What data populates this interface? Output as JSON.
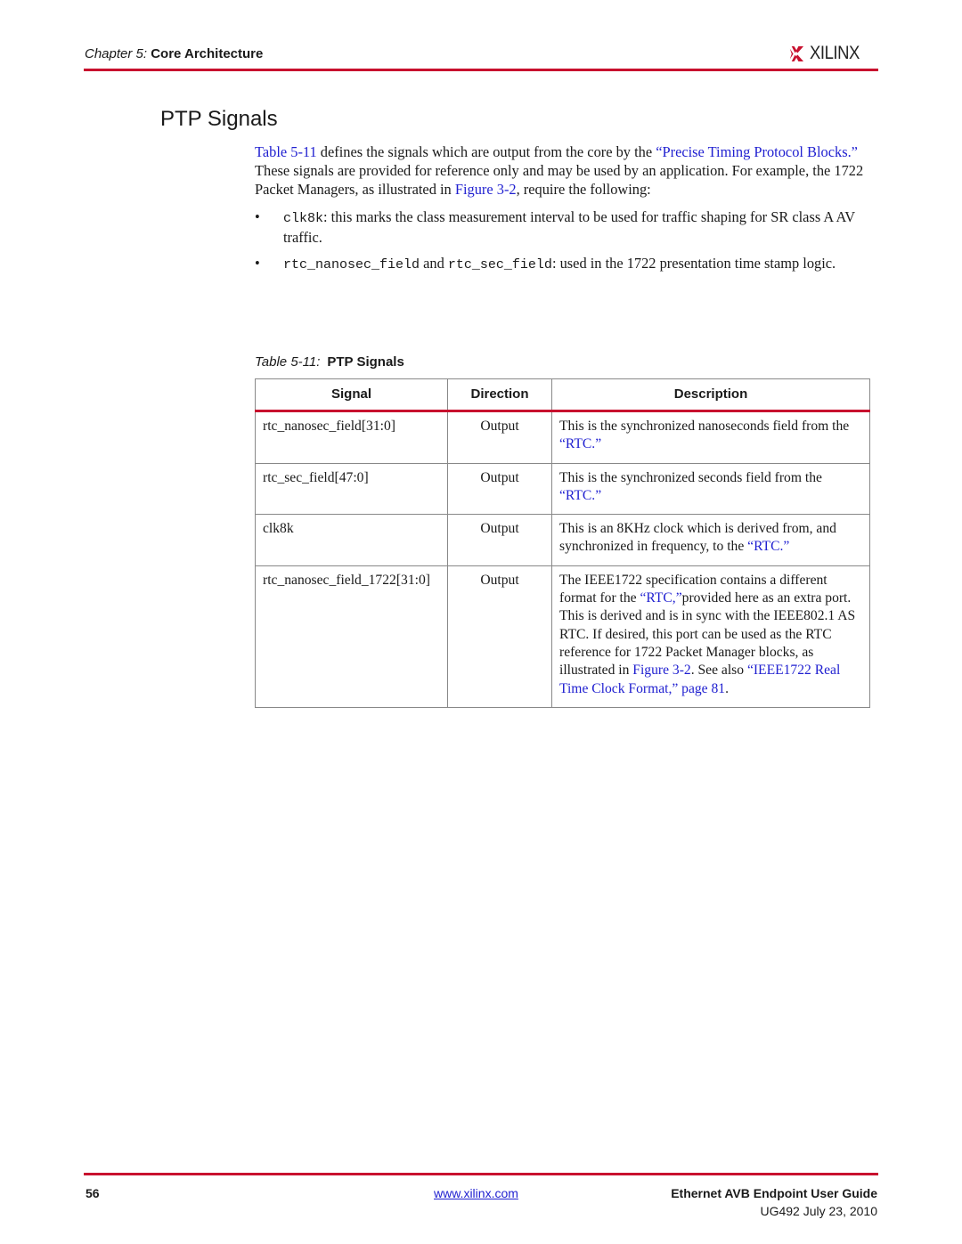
{
  "header": {
    "chapter_label": "Chapter 5:",
    "chapter_title": "Core Architecture",
    "logo_text": "XILINX",
    "logo_icon": "xilinx-logo-icon",
    "brand_color": "#c8102e"
  },
  "section_title": "PTP Signals",
  "intro": {
    "link_table": "Table 5-11",
    "text1": " defines the signals which are output from the core by the ",
    "link_ptb": "“Precise Timing Protocol Blocks.”",
    "text2": " These signals are provided for reference only and may be used by an application. For example, the 1722 Packet Managers, as illustrated in ",
    "link_fig": "Figure 3-2",
    "text3": ", require the following:"
  },
  "bullets": [
    {
      "code1": "clk8k",
      "text": ": this marks the class measurement interval to be used for traffic shaping for SR class A AV traffic."
    },
    {
      "code1": "rtc_nanosec_field",
      "mid": " and ",
      "code2": "rtc_sec_field",
      "text": ": used in the 1722 presentation time stamp logic."
    }
  ],
  "table": {
    "caption_label": "Table 5-11:",
    "caption_title": "PTP Signals",
    "headers": [
      "Signal",
      "Direction",
      "Description"
    ],
    "rows": [
      {
        "signal": "rtc_nanosec_field[31:0]",
        "direction": "Output",
        "desc_pre": "This is the synchronized nanoseconds field from the ",
        "desc_link": "“RTC.”"
      },
      {
        "signal": "rtc_sec_field[47:0]",
        "direction": "Output",
        "desc_pre": "This is the synchronized seconds field from the ",
        "desc_link": "“RTC.”"
      },
      {
        "signal": "clk8k",
        "direction": "Output",
        "desc_pre": "This is an 8KHz clock which is derived from, and synchronized in frequency, to the ",
        "desc_link": "“RTC.”"
      },
      {
        "signal": "rtc_nanosec_field_1722[31:0]",
        "direction": "Output",
        "desc_pre": "The IEEE1722 specification contains a different format for the ",
        "desc_link": "“RTC,”",
        "desc_mid": "provided here as an extra port. This is derived and is in sync with the IEEE802.1 AS RTC. If desired, this port can be used as the RTC reference for 1722 Packet Manager blocks, as illustrated in ",
        "desc_link2": "Figure 3-2",
        "desc_mid2": ". See also ",
        "desc_link3": "“IEEE1722 Real Time Clock Format,” page 81",
        "desc_end": "."
      }
    ]
  },
  "footer": {
    "page_number": "56",
    "url": "www.xilinx.com",
    "doc_title": "Ethernet AVB Endpoint User Guide",
    "doc_id_date": "UG492 July 23, 2010"
  }
}
